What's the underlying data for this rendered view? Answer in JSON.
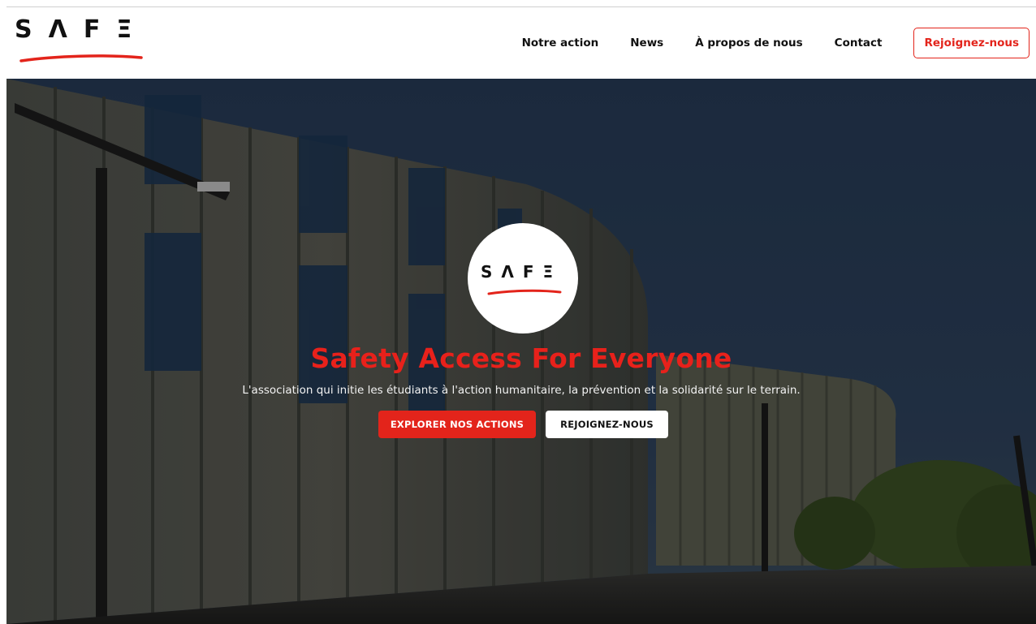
{
  "brand": {
    "logo_text": "SΛFΞ",
    "accent_color": "#e3241b"
  },
  "nav": {
    "items": [
      {
        "label": "Notre action"
      },
      {
        "label": "News"
      },
      {
        "label": "À propos de nous"
      },
      {
        "label": "Contact"
      }
    ],
    "cta_label": "Rejoignez-nous"
  },
  "hero": {
    "logo_text": "SΛFΞ",
    "title": "Safety Access For Everyone",
    "subtitle": "L'association qui initie les étudiants à l'action humanitaire, la prévention et la solidarité sur le terrain.",
    "primary_button": "EXPLORER NOS ACTIONS",
    "secondary_button": "REJOIGNEZ-NOUS"
  }
}
